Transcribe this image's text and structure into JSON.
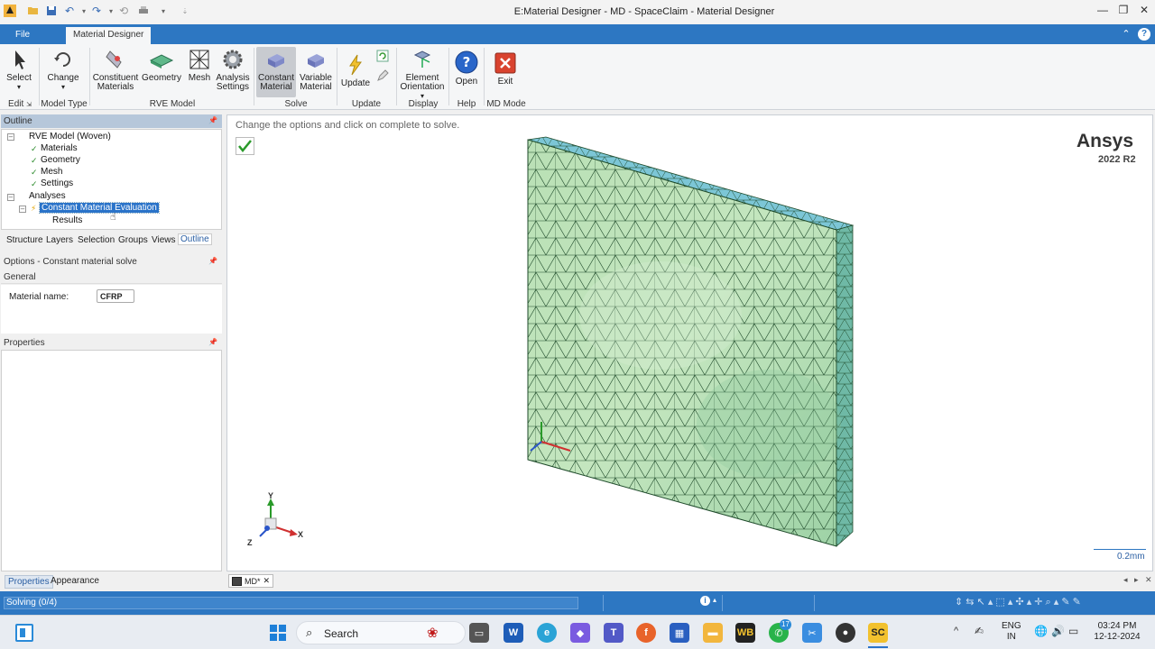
{
  "window": {
    "title": "E:Material Designer - MD - SpaceClaim - Material Designer"
  },
  "ribbon": {
    "tabs": [
      {
        "label": "File"
      },
      {
        "label": "Material Designer"
      }
    ],
    "buttons": {
      "select": "Select",
      "change": "Change",
      "constituent": "Constituent Materials",
      "geometry": "Geometry",
      "mesh": "Mesh",
      "analysis": "Analysis Settings",
      "constant": "Constant Material",
      "variable": "Variable Material",
      "update": "Update",
      "element_orientation": "Element Orientation",
      "open": "Open",
      "exit": "Exit"
    },
    "groups": {
      "edit": "Edit",
      "model_type": "Model Type",
      "rve_model": "RVE Model",
      "solve": "Solve",
      "update": "Update",
      "display": "Display",
      "help": "Help",
      "md_mode": "MD Mode"
    }
  },
  "outline": {
    "header": "Outline",
    "tree": {
      "root": "RVE Model (Woven)",
      "materials": "Materials",
      "geometry": "Geometry",
      "mesh": "Mesh",
      "settings": "Settings",
      "analyses": "Analyses",
      "evaluation": "Constant Material Evaluation",
      "results": "Results"
    },
    "check_mark": "✓"
  },
  "panel_tabs": [
    {
      "label": "Structure"
    },
    {
      "label": "Layers"
    },
    {
      "label": "Selection"
    },
    {
      "label": "Groups"
    },
    {
      "label": "Views"
    },
    {
      "label": "Outline"
    }
  ],
  "options": {
    "header": "Options - Constant material solve",
    "section": "General",
    "material_label": "Material name:",
    "material_value": "CFRP"
  },
  "properties": {
    "header": "Properties"
  },
  "bottom_tabs": [
    {
      "label": "Properties"
    },
    {
      "label": "Appearance"
    }
  ],
  "viewport": {
    "hint": "Change the options and click on complete to solve.",
    "brand": "Ansys",
    "version": "2022 R2",
    "scale": "0.2mm",
    "axis_x": "X",
    "axis_y": "Y",
    "axis_z": "Z"
  },
  "doc_tab": {
    "label": "MD*"
  },
  "status": {
    "text": "Solving (0/4)",
    "progress": 0.0
  },
  "taskbar": {
    "search": "Search",
    "lang_top": "ENG",
    "lang_bottom": "IN",
    "time": "03:24 PM",
    "date": "12-12-2024",
    "badge": "17"
  },
  "colors": {
    "accent": "#2d77c2",
    "mesh_fill": "#a8d8a8",
    "mesh_line": "#1e4a2a"
  }
}
